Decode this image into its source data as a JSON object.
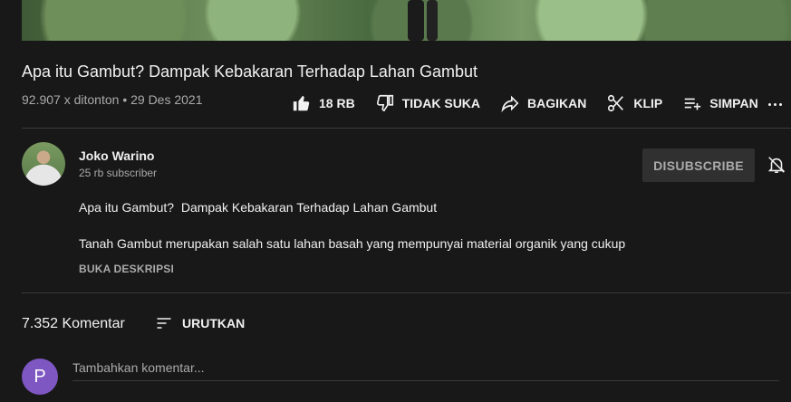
{
  "video": {
    "title": "Apa itu Gambut? Dampak Kebakaran Terhadap Lahan Gambut",
    "views": "92.907 x ditonton",
    "separator": "•",
    "date": "29 Des 2021"
  },
  "actions": {
    "like_count": "18 RB",
    "dislike_label": "TIDAK SUKA",
    "share_label": "BAGIKAN",
    "clip_label": "KLIP",
    "save_label": "SIMPAN"
  },
  "channel": {
    "name": "Joko Warino",
    "subscribers": "25 rb subscriber",
    "unsubscribe_label": "DISUBSCRIBE"
  },
  "description": {
    "line1": "Apa itu Gambut?  Dampak Kebakaran Terhadap Lahan Gambut",
    "line2": "Tanah Gambut merupakan salah satu lahan basah yang mempunyai material organik yang cukup",
    "show_more": "BUKA DESKRIPSI"
  },
  "comments": {
    "count_label": "7.352 Komentar",
    "sort_label": "URUTKAN",
    "user_initial": "P",
    "placeholder": "Tambahkan komentar..."
  },
  "icons": {
    "like": "thumb-up-icon",
    "dislike": "thumb-down-icon",
    "share": "share-icon",
    "clip": "scissors-icon",
    "save": "playlist-add-icon",
    "more": "more-horizontal-icon",
    "bell": "notifications-off-icon",
    "sort": "sort-icon"
  },
  "colors": {
    "background": "#181818",
    "user_avatar": "#7e57c2",
    "unsubscribe_bg": "#303030"
  }
}
